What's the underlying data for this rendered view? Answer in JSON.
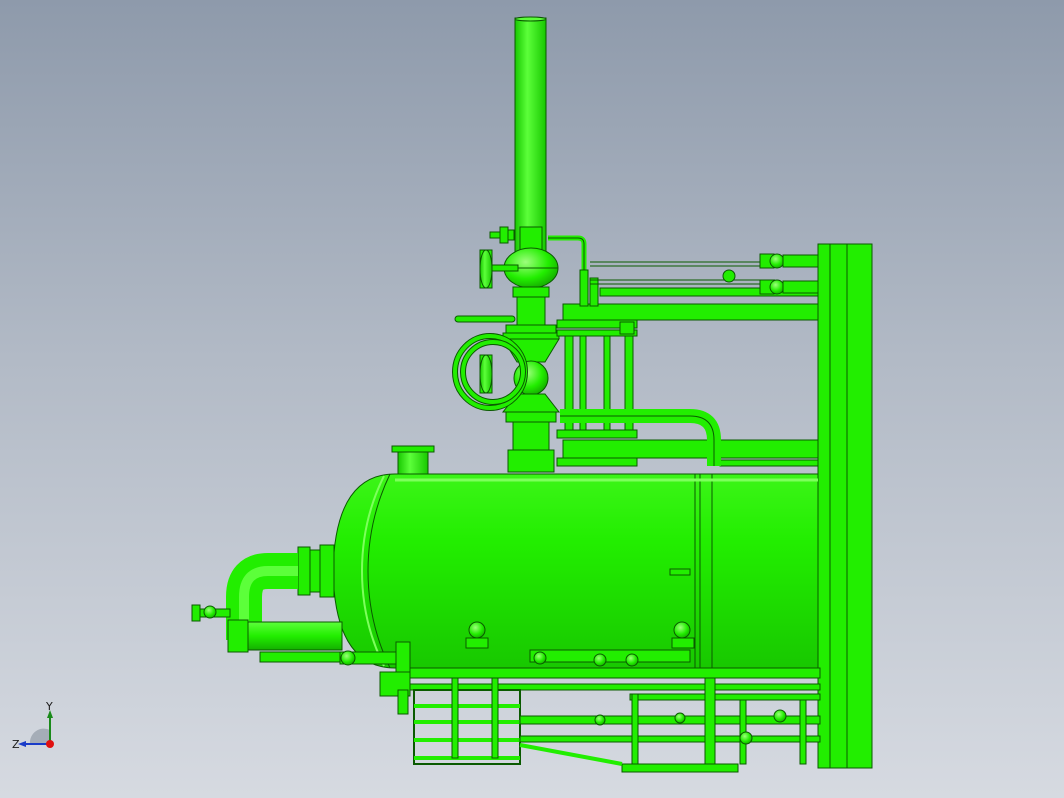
{
  "viewport": {
    "background_top": "#8e9aab",
    "background_bottom": "#d6dae1"
  },
  "model": {
    "color": "#22ee00",
    "edge_color": "#0a5a00",
    "highlight_color": "#7dff5c",
    "shade_color": "#14b800"
  },
  "triad": {
    "y_label": "Y",
    "z_label": "Z",
    "y_color": "#1a8a1a",
    "z_color": "#1a3cc8",
    "origin_color": "#e01010",
    "icon": "axis-triad-icon"
  }
}
